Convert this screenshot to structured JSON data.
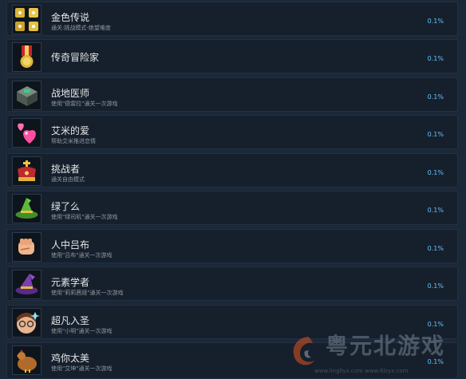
{
  "achievements": [
    {
      "title": "金色传说",
      "desc": "通关:挑战模式-绝望难度",
      "pct": "0.1%",
      "icon": "gold-dice-icon"
    },
    {
      "title": "传奇冒险家",
      "desc": "",
      "pct": "0.1%",
      "icon": "gold-medal-icon"
    },
    {
      "title": "战地医师",
      "desc": "使用\"德雷拉\"通关一次游戏",
      "pct": "0.1%",
      "icon": "medic-crate-icon"
    },
    {
      "title": "艾米的爱",
      "desc": "帮助艾米推进恋情",
      "pct": "0.1%",
      "icon": "pink-hearts-icon"
    },
    {
      "title": "挑战者",
      "desc": "通关自由模式",
      "pct": "0.1%",
      "icon": "crown-icon"
    },
    {
      "title": "绿了么",
      "desc": "使用\"绿司机\"通关一次游戏",
      "pct": "0.1%",
      "icon": "green-witch-hat-icon"
    },
    {
      "title": "人中吕布",
      "desc": "使用\"吕布\"通关一次游戏",
      "pct": "0.1%",
      "icon": "fist-icon"
    },
    {
      "title": "元素学者",
      "desc": "使用\"莉莉茜娅\"通关一次游戏",
      "pct": "0.1%",
      "icon": "purple-wizard-hat-icon"
    },
    {
      "title": "超凡入圣",
      "desc": "使用\"小明\"通关一次游戏",
      "pct": "0.1%",
      "icon": "glasses-boy-icon"
    },
    {
      "title": "鸡你太美",
      "desc": "使用\"艾坤\"通关一次游戏",
      "pct": "0.1%",
      "icon": "chicken-icon"
    }
  ],
  "watermark": {
    "title": "粤元北游戏",
    "url": "www.lingliyx.com  www.6lzyx.com"
  },
  "colors": {
    "background": "#1b2838",
    "row": "#16202d",
    "percent": "#66c0f4",
    "title": "#e6e6e6",
    "desc": "#8f98a0"
  }
}
